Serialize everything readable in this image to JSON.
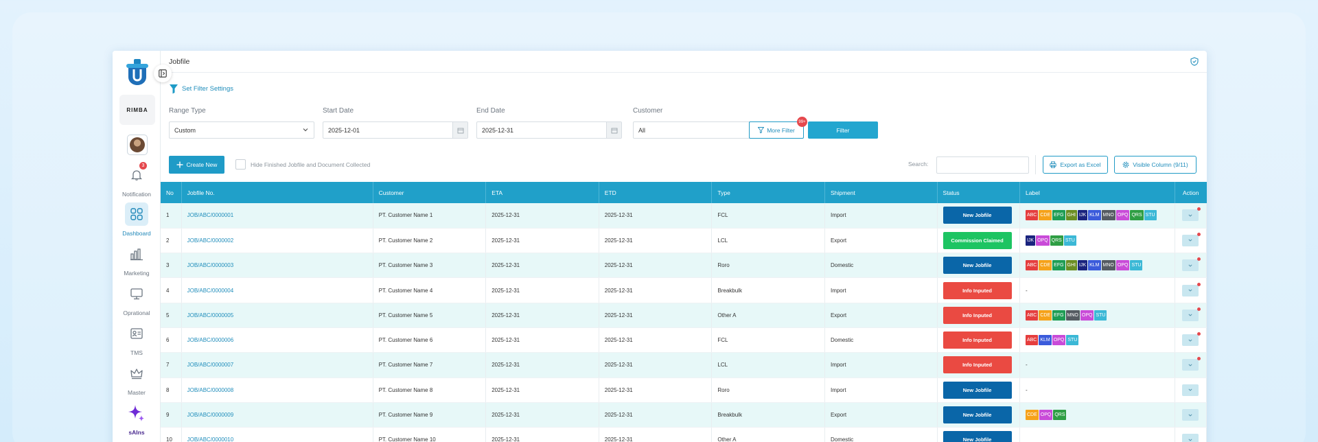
{
  "colors": {
    "accent": "#20a0c9",
    "new_jobfile": "#0a66a8",
    "commission": "#1dc462",
    "info": "#ea4a42",
    "badge": "#e5484d"
  },
  "sidebar": {
    "company_logo_text": "RIMBA",
    "notification_count": "3",
    "items": [
      {
        "label": "Notification",
        "icon": "bell-icon"
      },
      {
        "label": "Dashboard",
        "icon": "grid-icon",
        "active": true
      },
      {
        "label": "Marketing",
        "icon": "bar-chart-icon"
      },
      {
        "label": "Oprational",
        "icon": "monitor-icon"
      },
      {
        "label": "TMS",
        "icon": "id-card-icon"
      },
      {
        "label": "Master",
        "icon": "crown-icon"
      },
      {
        "label": "sAIns",
        "icon": "sparkle-icon"
      }
    ]
  },
  "header": {
    "title": "Jobfile"
  },
  "filter": {
    "settings_label": "Set Filter Settings",
    "range_type_label": "Range Type",
    "range_type_value": "Custom",
    "start_date_label": "Start Date",
    "start_date_value": "2025-12-01",
    "end_date_label": "End Date",
    "end_date_value": "2025-12-31",
    "customer_label": "Customer",
    "customer_value": "All",
    "more_filter_label": "More Filter",
    "more_filter_count": "99+",
    "filter_button": "Filter"
  },
  "toolbar": {
    "create_new": "Create New",
    "hide_finished_label": "Hide Finished Jobfile and Document Collected",
    "search_label": "Search:",
    "export_label": "Export as Excel",
    "visible_column_label": "Visible Column (9/11)"
  },
  "table": {
    "columns": [
      "No",
      "Jobfile No.",
      "Customer",
      "ETA",
      "ETD",
      "Type",
      "Shipment",
      "Status",
      "Label",
      "Action"
    ],
    "rows": [
      {
        "no": "1",
        "job": "JOB/ABC/0000001",
        "customer": "PT. Customer Name 1",
        "eta": "2025-12-31",
        "etd": "2025-12-31",
        "type": "FCL",
        "shipment": "Import",
        "status": "New Jobfile",
        "status_color": "#0a66a8",
        "labels": [
          "ABC",
          "CDE",
          "EFG",
          "GHI",
          "IJK",
          "KLM",
          "MNO",
          "OPQ",
          "QRS",
          "STU"
        ],
        "dot": true
      },
      {
        "no": "2",
        "job": "JOB/ABC/0000002",
        "customer": "PT. Customer Name 2",
        "eta": "2025-12-31",
        "etd": "2025-12-31",
        "type": "LCL",
        "shipment": "Export",
        "status": "Commission Claimed",
        "status_color": "#1dc462",
        "labels": [
          "IJK",
          "OPQ",
          "QRS",
          "STU"
        ],
        "dot": true
      },
      {
        "no": "3",
        "job": "JOB/ABC/0000003",
        "customer": "PT. Customer Name 3",
        "eta": "2025-12-31",
        "etd": "2025-12-31",
        "type": "Roro",
        "shipment": "Domestic",
        "status": "New Jobfile",
        "status_color": "#0a66a8",
        "labels": [
          "ABC",
          "CDE",
          "EFG",
          "GHI",
          "IJK",
          "KLM",
          "MNO",
          "OPQ",
          "STU"
        ],
        "dot": true
      },
      {
        "no": "4",
        "job": "JOB/ABC/0000004",
        "customer": "PT. Customer Name 4",
        "eta": "2025-12-31",
        "etd": "2025-12-31",
        "type": "Breakbulk",
        "shipment": "Import",
        "status": "Info Inputed",
        "status_color": "#ea4a42",
        "labels": [],
        "label_text": "-",
        "dot": true
      },
      {
        "no": "5",
        "job": "JOB/ABC/0000005",
        "customer": "PT. Customer Name 5",
        "eta": "2025-12-31",
        "etd": "2025-12-31",
        "type": "Other A",
        "shipment": "Export",
        "status": "Info Inputed",
        "status_color": "#ea4a42",
        "labels": [
          "ABC",
          "CDE",
          "EFG",
          "MNO",
          "OPQ",
          "STU"
        ],
        "dot": true
      },
      {
        "no": "6",
        "job": "JOB/ABC/0000006",
        "customer": "PT. Customer Name 6",
        "eta": "2025-12-31",
        "etd": "2025-12-31",
        "type": "FCL",
        "shipment": "Domestic",
        "status": "Info Inputed",
        "status_color": "#ea4a42",
        "labels": [
          "ABC",
          "KLM",
          "OPQ",
          "STU"
        ],
        "dot": true
      },
      {
        "no": "7",
        "job": "JOB/ABC/0000007",
        "customer": "PT. Customer Name 7",
        "eta": "2025-12-31",
        "etd": "2025-12-31",
        "type": "LCL",
        "shipment": "Import",
        "status": "Info Inputed",
        "status_color": "#ea4a42",
        "labels": [],
        "label_text": "-",
        "dot": true
      },
      {
        "no": "8",
        "job": "JOB/ABC/0000008",
        "customer": "PT. Customer Name 8",
        "eta": "2025-12-31",
        "etd": "2025-12-31",
        "type": "Roro",
        "shipment": "Import",
        "status": "New Jobfile",
        "status_color": "#0a66a8",
        "labels": [],
        "label_text": "-",
        "dot": false
      },
      {
        "no": "9",
        "job": "JOB/ABC/0000009",
        "customer": "PT. Customer Name 9",
        "eta": "2025-12-31",
        "etd": "2025-12-31",
        "type": "Breakbulk",
        "shipment": "Export",
        "status": "New Jobfile",
        "status_color": "#0a66a8",
        "labels": [
          "CDE",
          "OPQ",
          "QRS"
        ],
        "dot": false
      },
      {
        "no": "10",
        "job": "JOB/ABC/0000010",
        "customer": "PT. Customer Name 10",
        "eta": "2025-12-31",
        "etd": "2025-12-31",
        "type": "Other A",
        "shipment": "Domestic",
        "status": "New Jobfile",
        "status_color": "#0a66a8",
        "labels": [],
        "label_text": "",
        "dot": false
      }
    ]
  },
  "label_colors": {
    "ABC": "#e53e3e",
    "CDE": "#f6a21a",
    "EFG": "#1f9d55",
    "GHI": "#6b8e23",
    "IJK": "#1a237e",
    "KLM": "#3b5bdb",
    "MNO": "#555b62",
    "OPQ": "#c94bd8",
    "QRS": "#2f9e44",
    "STU": "#3bb8d6"
  }
}
